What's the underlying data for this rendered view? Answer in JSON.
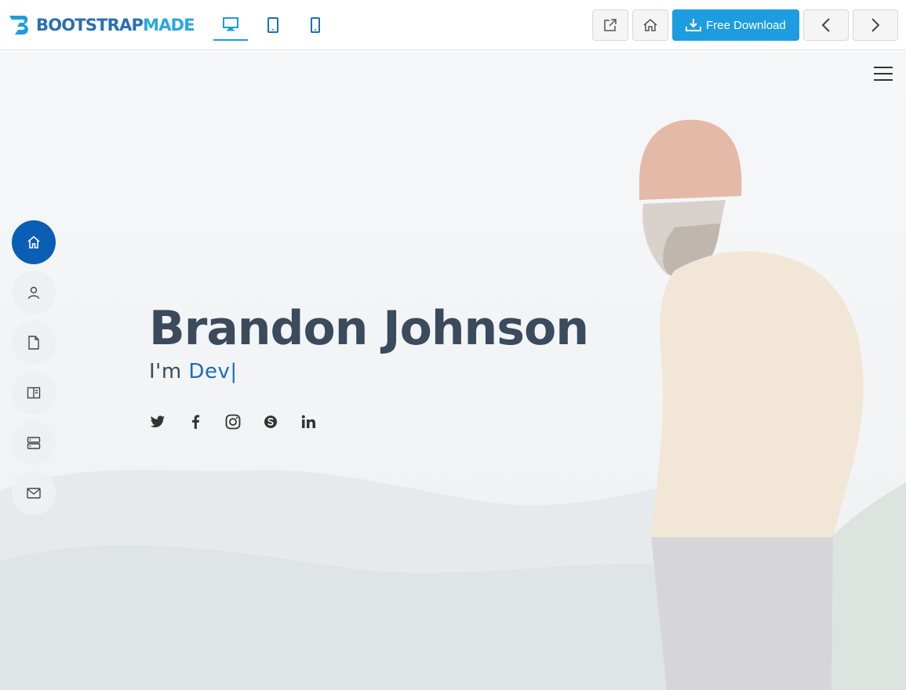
{
  "topbar": {
    "brand_part1": "BOOTSTRAP",
    "brand_part2": "MADE",
    "device_buttons": [
      {
        "name": "desktop",
        "active": true
      },
      {
        "name": "tablet",
        "active": false
      },
      {
        "name": "mobile",
        "active": false
      }
    ],
    "download_label": "Free Download",
    "accent_color": "#1d9de0"
  },
  "hero": {
    "name": "Brandon Johnson",
    "intro_prefix": "I'm ",
    "typed_text": "Dev",
    "caret": "|",
    "nav_items": [
      {
        "icon": "home-icon",
        "active": true
      },
      {
        "icon": "person-icon",
        "active": false
      },
      {
        "icon": "file-icon",
        "active": false
      },
      {
        "icon": "book-icon",
        "active": false
      },
      {
        "icon": "server-icon",
        "active": false
      },
      {
        "icon": "envelope-icon",
        "active": false
      }
    ],
    "social_icons": [
      "twitter-icon",
      "facebook-icon",
      "instagram-icon",
      "skype-icon",
      "linkedin-icon"
    ],
    "active_nav_color": "#0a5fb4",
    "heading_color": "#3b4a5c"
  }
}
